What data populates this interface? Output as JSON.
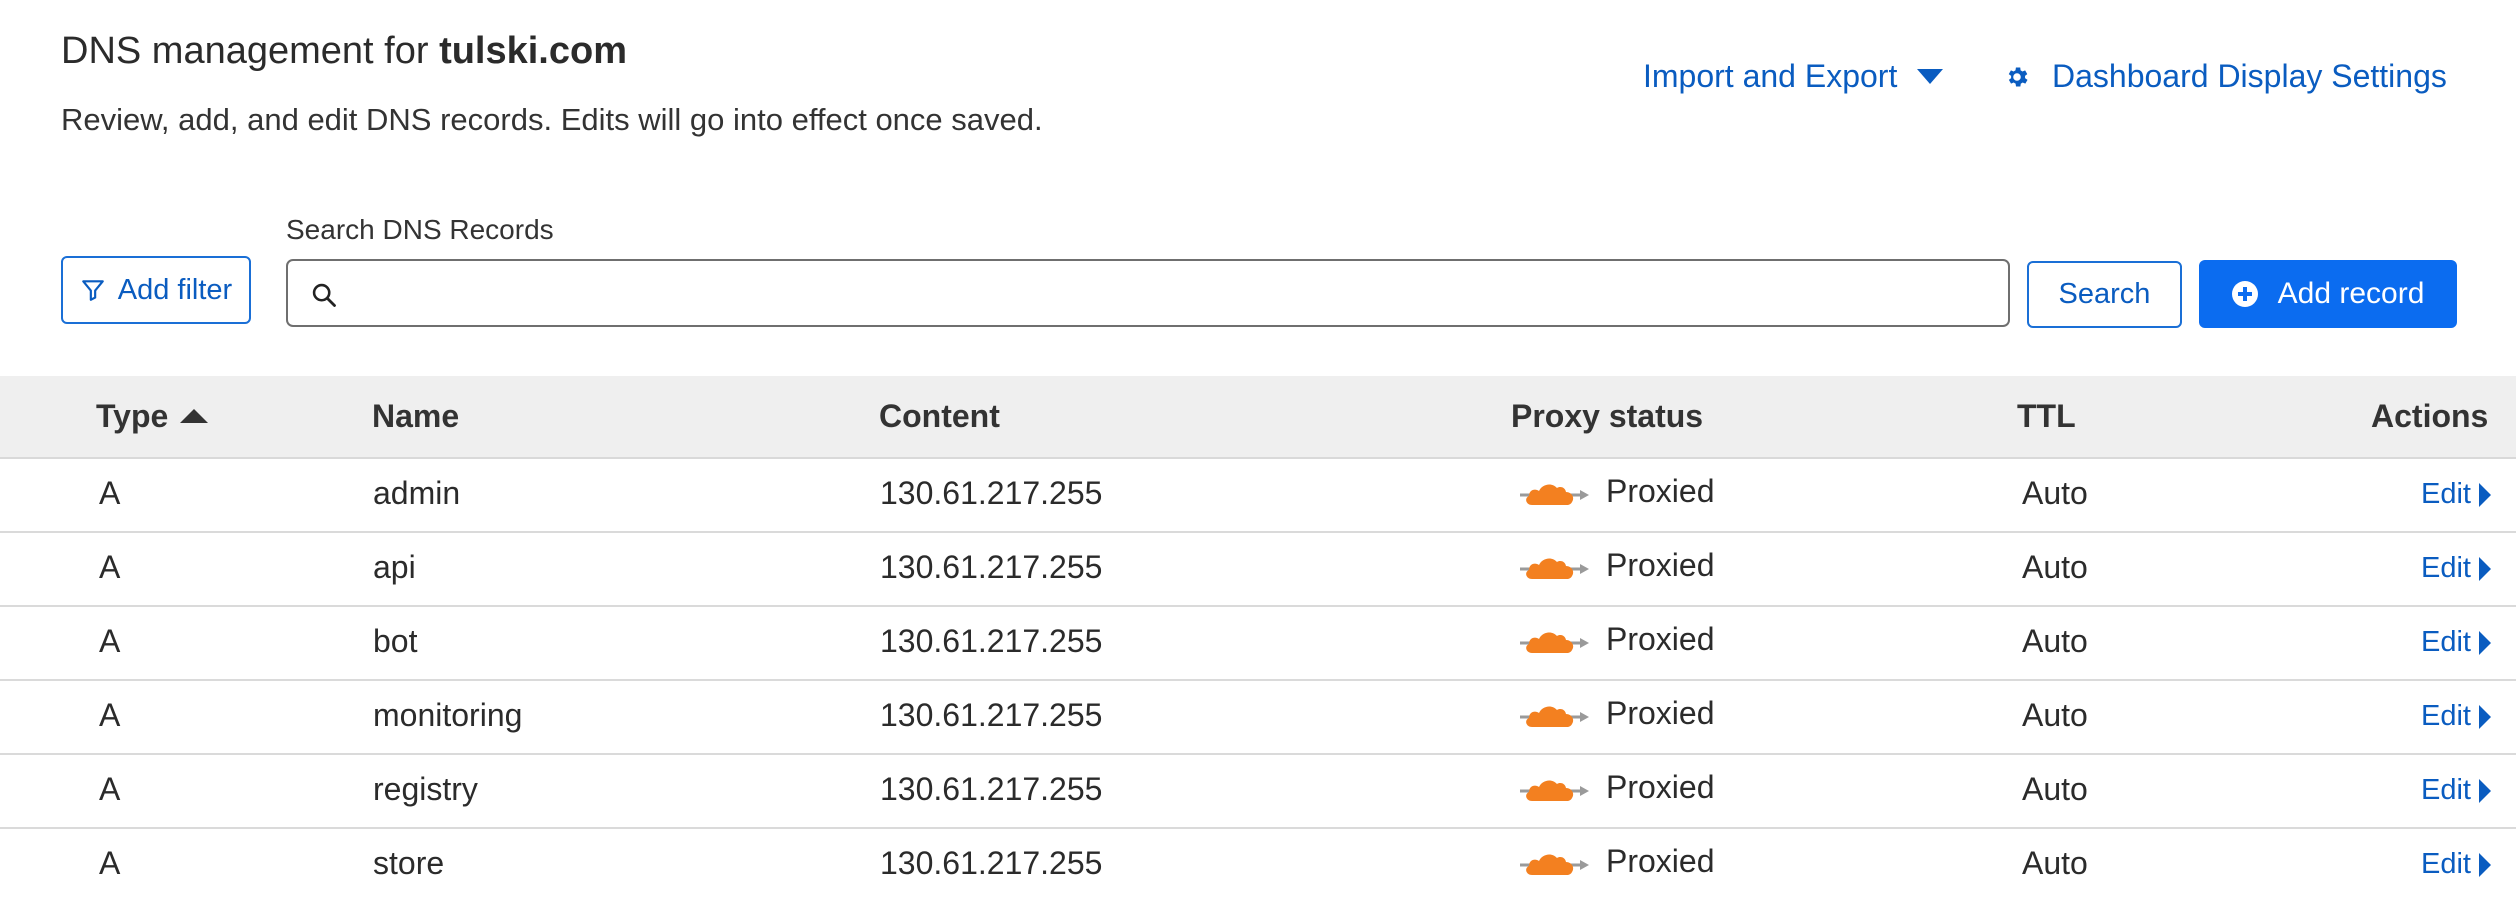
{
  "header": {
    "title_prefix": "DNS management for ",
    "zone": "tulski.com",
    "subtitle": "Review, add, and edit DNS records. Edits will go into effect once saved.",
    "import_export_label": "Import and Export",
    "dashboard_settings_label": "Dashboard Display Settings"
  },
  "toolbar": {
    "add_filter_label": "Add filter",
    "search_label": "Search DNS Records",
    "search_value": "",
    "search_button_label": "Search",
    "add_record_label": "Add record"
  },
  "table": {
    "columns": {
      "type": "Type",
      "name": "Name",
      "content": "Content",
      "proxy": "Proxy status",
      "ttl": "TTL",
      "actions": "Actions"
    },
    "sort": {
      "column": "Type",
      "direction": "ascending"
    },
    "rows": [
      {
        "type": "A",
        "name": "admin",
        "content": "130.61.217.255",
        "proxy": "Proxied",
        "ttl": "Auto",
        "action": "Edit"
      },
      {
        "type": "A",
        "name": "api",
        "content": "130.61.217.255",
        "proxy": "Proxied",
        "ttl": "Auto",
        "action": "Edit"
      },
      {
        "type": "A",
        "name": "bot",
        "content": "130.61.217.255",
        "proxy": "Proxied",
        "ttl": "Auto",
        "action": "Edit"
      },
      {
        "type": "A",
        "name": "monitoring",
        "content": "130.61.217.255",
        "proxy": "Proxied",
        "ttl": "Auto",
        "action": "Edit"
      },
      {
        "type": "A",
        "name": "registry",
        "content": "130.61.217.255",
        "proxy": "Proxied",
        "ttl": "Auto",
        "action": "Edit"
      },
      {
        "type": "A",
        "name": "store",
        "content": "130.61.217.255",
        "proxy": "Proxied",
        "ttl": "Auto",
        "action": "Edit"
      }
    ]
  },
  "icons": {
    "proxy": "orange-cloud-icon",
    "filter": "filter-icon",
    "search": "search-icon",
    "gear": "gear-icon",
    "add": "plus-circle-icon"
  },
  "colors": {
    "link": "#0a5cc0",
    "primary_button": "#0b6cf0",
    "cloud": "#f38020",
    "header_bg": "#efefef"
  }
}
